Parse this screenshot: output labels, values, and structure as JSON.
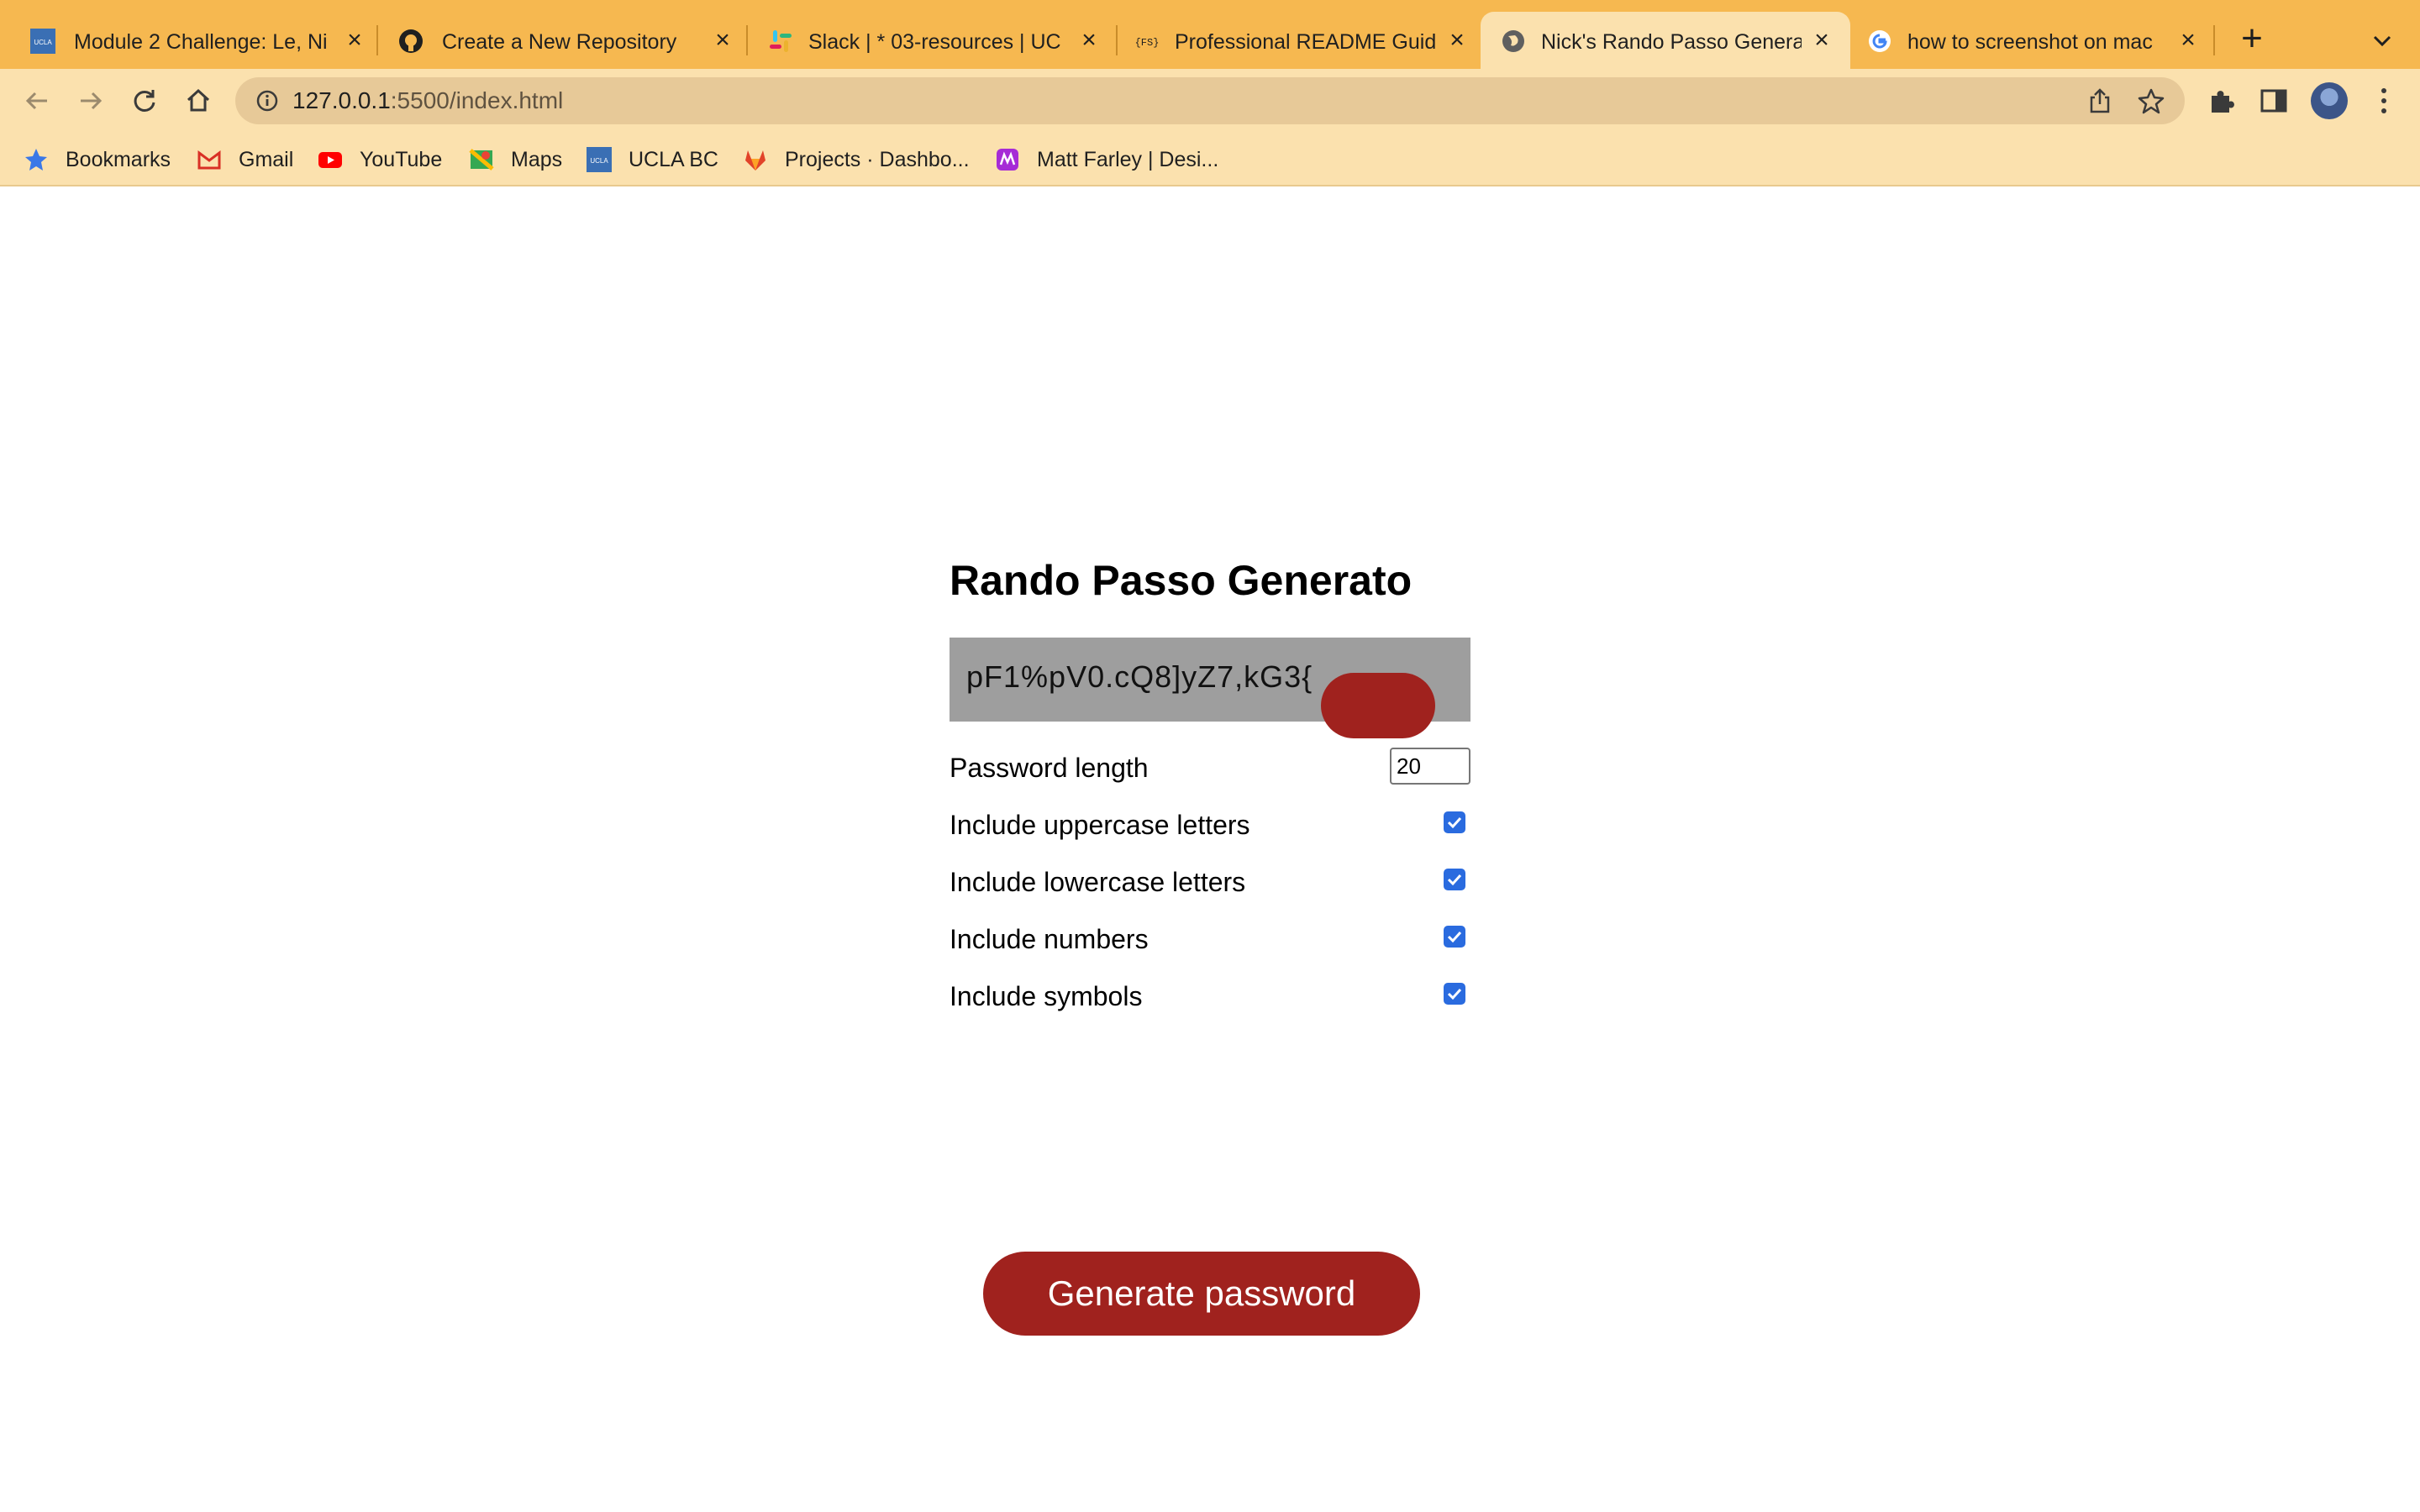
{
  "browser": {
    "tabs": [
      {
        "title": "Module 2 Challenge: Le, Nic",
        "favicon": "ucla-icon"
      },
      {
        "title": "Create a New Repository",
        "favicon": "github-icon"
      },
      {
        "title": "Slack | * 03-resources | UC",
        "favicon": "slack-icon"
      },
      {
        "title": "Professional README Guide",
        "favicon": "fs-icon"
      },
      {
        "title": "Nick's Rando Passo Genera",
        "favicon": "globe-icon",
        "active": true
      },
      {
        "title": "how to screenshot on mac",
        "favicon": "google-icon"
      }
    ],
    "address": {
      "host": "127.0.0.1",
      "path": ":5500/index.html"
    },
    "bookmarks": [
      {
        "label": "Bookmarks",
        "icon": "star-icon"
      },
      {
        "label": "Gmail",
        "icon": "gmail-icon"
      },
      {
        "label": "YouTube",
        "icon": "youtube-icon"
      },
      {
        "label": "Maps",
        "icon": "maps-icon"
      },
      {
        "label": "UCLA BC",
        "icon": "ucla-icon"
      },
      {
        "label": "Projects · Dashbo...",
        "icon": "gitlab-icon"
      },
      {
        "label": "Matt Farley | Desi...",
        "icon": "portfolio-icon"
      }
    ],
    "colors": {
      "tabstrip": "#f6b850",
      "toolbar": "#fbe1ae"
    }
  },
  "app": {
    "title": "Rando Passo Generato",
    "password": "pF1%pV0.cQ8]yZ7,kG3{",
    "options": {
      "length_label": "Password length",
      "length_value": "20",
      "uppercase_label": "Include uppercase letters",
      "lowercase_label": "Include lowercase letters",
      "numbers_label": "Include numbers",
      "symbols_label": "Include symbols",
      "uppercase_checked": true,
      "lowercase_checked": true,
      "numbers_checked": true,
      "symbols_checked": true
    },
    "generate_label": "Generate password",
    "colors": {
      "accent": "#a0221e",
      "password_bg": "#9e9e9e",
      "checkbox": "#2a6bdf"
    }
  }
}
